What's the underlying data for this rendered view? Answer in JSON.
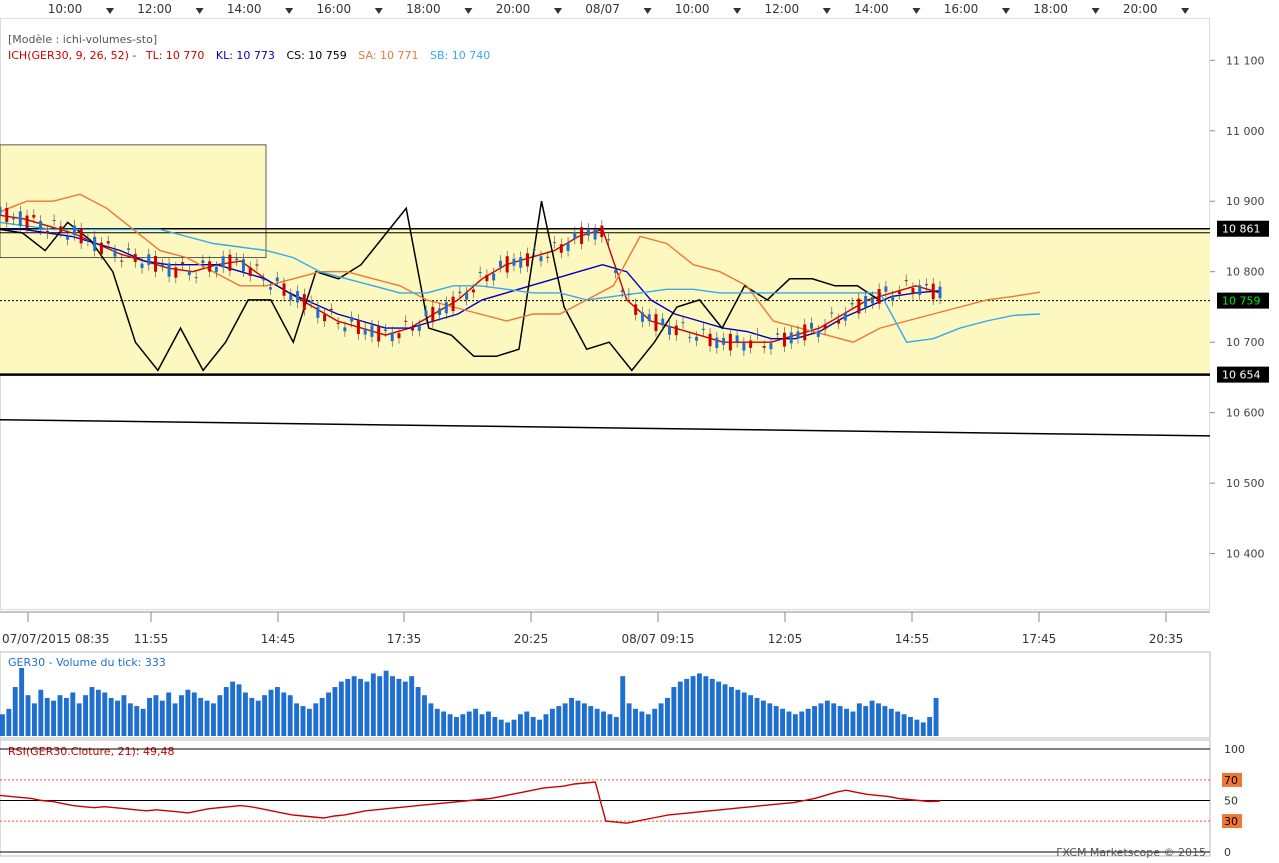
{
  "top_axis": {
    "labels": [
      "10:00",
      "12:00",
      "14:00",
      "16:00",
      "18:00",
      "20:00",
      "08/07",
      "10:00",
      "12:00",
      "14:00",
      "16:00",
      "18:00",
      "20:00"
    ]
  },
  "legend": {
    "model": "[Modèle : ichi-volumes-sto]",
    "ich_prefix": "ICH(GER30, 9, 26, 52) -",
    "tl": "TL: 10 770",
    "kl": "KL: 10 773",
    "cs": "CS: 10 759",
    "sa": "SA: 10 771",
    "sb": "SB: 10 740"
  },
  "colors": {
    "tl": "#cc0000",
    "kl": "#0000bb",
    "cs": "#000000",
    "sa": "#ee7733",
    "sb": "#33aaee",
    "volume": "#1e6fd0",
    "rsi": "#cc0000",
    "zone": "#fdf8c0"
  },
  "bottom_axis": {
    "labels": [
      "07/07/2015 08:35",
      "11:55",
      "14:45",
      "17:35",
      "20:25",
      "08/07 09:15",
      "12:05",
      "14:55",
      "17:45",
      "20:35"
    ]
  },
  "volume_panel": {
    "title": "GER30 - Volume du tick: 333"
  },
  "rsi_panel": {
    "title": "RSI(GER30.Cloture, 21): 49,48",
    "levels": [
      "100",
      "70",
      "50",
      "30",
      "0"
    ]
  },
  "footer": "FXCM Marketscope © 2015",
  "chart_data": {
    "type": "line",
    "instrument": "GER30",
    "y_axis": {
      "tick_labels": [
        "11 100",
        "11 000",
        "10 900",
        "10 800",
        "10 700",
        "10 600",
        "10 500",
        "10 400"
      ],
      "ylim": [
        10320,
        11160
      ]
    },
    "price_tags": [
      "10 861",
      "10 759",
      "10 654"
    ],
    "horizontal_levels": [
      10861,
      10759,
      10654
    ],
    "rectangle_zone": {
      "y_range": [
        10654,
        10861
      ]
    },
    "trendline": {
      "from": [
        0,
        10590
      ],
      "to": [
        1,
        10567
      ]
    },
    "price_range_step1": [
      10795,
      10885
    ],
    "series": [
      {
        "name": "TL",
        "values": [
          10880,
          10875,
          10865,
          10855,
          10840,
          10825,
          10815,
          10805,
          10800,
          10810,
          10815,
          10790,
          10770,
          10750,
          10730,
          10720,
          10710,
          10720,
          10740,
          10760,
          10790,
          10810,
          10820,
          10830,
          10850,
          10860,
          10760,
          10730,
          10720,
          10710,
          10700,
          10700,
          10700,
          10710,
          10720,
          10740,
          10760,
          10770,
          10780,
          10770
        ]
      },
      {
        "name": "KL",
        "values": [
          10860,
          10860,
          10855,
          10850,
          10840,
          10830,
          10815,
          10810,
          10810,
          10810,
          10800,
          10790,
          10770,
          10755,
          10740,
          10730,
          10720,
          10720,
          10730,
          10740,
          10760,
          10770,
          10780,
          10790,
          10800,
          10810,
          10800,
          10760,
          10740,
          10730,
          10720,
          10715,
          10705,
          10705,
          10715,
          10735,
          10750,
          10765,
          10770,
          10773
        ]
      },
      {
        "name": "CS",
        "values": [
          10860,
          10855,
          10830,
          10870,
          10845,
          10800,
          10700,
          10660,
          10720,
          10660,
          10700,
          10760,
          10760,
          10700,
          10800,
          10790,
          10810,
          10850,
          10890,
          10720,
          10710,
          10680,
          10680,
          10690,
          10900,
          10750,
          10690,
          10700,
          10660,
          10700,
          10750,
          10760,
          10720,
          10780,
          10760,
          10790,
          10790,
          10780,
          10780,
          10759
        ]
      },
      {
        "name": "SA",
        "values": [
          10885,
          10900,
          10900,
          10910,
          10890,
          10860,
          10830,
          10820,
          10800,
          10780,
          10780,
          10790,
          10800,
          10800,
          10790,
          10780,
          10760,
          10750,
          10740,
          10730,
          10740,
          10740,
          10760,
          10780,
          10850,
          10840,
          10810,
          10800,
          10780,
          10730,
          10720,
          10710,
          10700,
          10720,
          10730,
          10740,
          10750,
          10760,
          10765,
          10771
        ]
      },
      {
        "name": "SB",
        "values": [
          10870,
          10865,
          10860,
          10860,
          10860,
          10860,
          10860,
          10850,
          10840,
          10835,
          10830,
          10820,
          10800,
          10790,
          10780,
          10770,
          10770,
          10780,
          10780,
          10775,
          10770,
          10770,
          10760,
          10765,
          10770,
          10775,
          10775,
          10770,
          10770,
          10770,
          10770,
          10770,
          10770,
          10770,
          10700,
          10705,
          10720,
          10730,
          10738,
          10740
        ]
      }
    ],
    "volume": [
      8,
      10,
      18,
      25,
      15,
      12,
      17,
      14,
      13,
      15,
      14,
      16,
      12,
      15,
      18,
      17,
      16,
      14,
      13,
      15,
      12,
      11,
      10,
      14,
      15,
      13,
      16,
      12,
      15,
      17,
      16,
      14,
      13,
      12,
      15,
      18,
      20,
      19,
      16,
      14,
      13,
      15,
      17,
      18,
      16,
      15,
      12,
      11,
      10,
      12,
      14,
      16,
      18,
      20,
      21,
      22,
      21,
      20,
      23,
      22,
      24,
      22,
      21,
      20,
      22,
      18,
      15,
      12,
      10,
      9,
      8,
      7,
      8,
      9,
      10,
      8,
      9,
      7,
      6,
      5,
      6,
      8,
      9,
      7,
      6,
      8,
      10,
      11,
      12,
      14,
      13,
      12,
      11,
      10,
      9,
      8,
      7,
      22,
      12,
      10,
      9,
      8,
      10,
      12,
      14,
      18,
      20,
      21,
      22,
      23,
      22,
      21,
      20,
      19,
      18,
      17,
      16,
      15,
      14,
      13,
      12,
      11,
      10,
      9,
      8,
      9,
      10,
      11,
      12,
      13,
      12,
      11,
      10,
      9,
      12,
      11,
      13,
      12,
      11,
      10,
      9,
      8,
      7,
      6,
      5,
      7,
      14
    ],
    "rsi": [
      55,
      54,
      53,
      52,
      50,
      49,
      47,
      45,
      44,
      43,
      44,
      43,
      42,
      41,
      40,
      41,
      40,
      39,
      38,
      40,
      42,
      43,
      44,
      45,
      44,
      42,
      40,
      38,
      36,
      35,
      34,
      33,
      35,
      36,
      38,
      40,
      41,
      42,
      43,
      44,
      45,
      46,
      47,
      48,
      49,
      50,
      51,
      52,
      54,
      56,
      58,
      60,
      62,
      63,
      64,
      66,
      67,
      68,
      30,
      29,
      28,
      30,
      32,
      34,
      36,
      37,
      38,
      39,
      40,
      41,
      42,
      43,
      44,
      45,
      46,
      47,
      48,
      50,
      52,
      55,
      58,
      60,
      58,
      56,
      55,
      54,
      52,
      51,
      50,
      49,
      49.48
    ],
    "rsi_ylim": [
      0,
      100
    ]
  }
}
